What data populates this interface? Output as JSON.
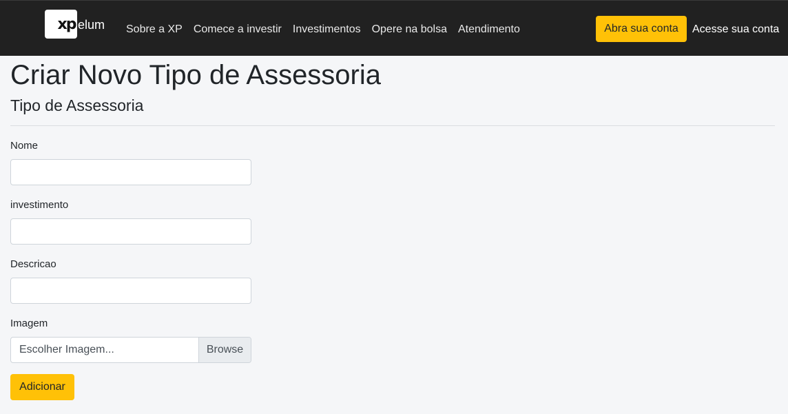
{
  "navbar": {
    "logo_mark": "xp",
    "logo_text": "elum",
    "links": [
      {
        "label": "Sobre a XP"
      },
      {
        "label": "Comece a investir"
      },
      {
        "label": "Investimentos"
      },
      {
        "label": "Opere na bolsa"
      },
      {
        "label": "Atendimento"
      }
    ],
    "open_account": "Abra sua conta",
    "access_account": "Acesse sua conta",
    "accent_color": "#ffc107",
    "background_color": "#212121"
  },
  "page": {
    "title": "Criar Novo Tipo de Assessoria",
    "subtitle": "Tipo de Assessoria"
  },
  "form": {
    "fields": [
      {
        "label": "Nome",
        "value": ""
      },
      {
        "label": "investimento",
        "value": ""
      },
      {
        "label": "Descricao",
        "value": ""
      }
    ],
    "image": {
      "label": "Imagem",
      "placeholder": "Escolher Imagem...",
      "browse": "Browse"
    },
    "submit": "Adicionar"
  }
}
